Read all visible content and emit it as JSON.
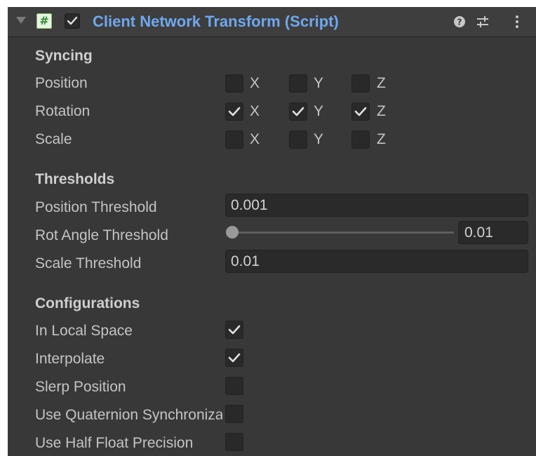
{
  "header": {
    "title": "Client Network Transform (Script)",
    "script_icon_glyph": "#",
    "enabled": true,
    "icons": [
      "foldout-arrow-icon",
      "script-icon",
      "help-icon",
      "settings-sliders-icon",
      "kebab-menu-icon"
    ]
  },
  "syncing": {
    "title": "Syncing",
    "rows": [
      {
        "label": "Position",
        "x": false,
        "y": false,
        "z": false
      },
      {
        "label": "Rotation",
        "x": true,
        "y": true,
        "z": true
      },
      {
        "label": "Scale",
        "x": false,
        "y": false,
        "z": false
      }
    ],
    "axis_labels": [
      "X",
      "Y",
      "Z"
    ]
  },
  "thresholds": {
    "title": "Thresholds",
    "position_threshold": {
      "label": "Position Threshold",
      "value": "0.001"
    },
    "rot_angle_threshold": {
      "label": "Rot Angle Threshold",
      "value": "0.01"
    },
    "scale_threshold": {
      "label": "Scale Threshold",
      "value": "0.01"
    }
  },
  "configurations": {
    "title": "Configurations",
    "items": [
      {
        "label": "In Local Space",
        "checked": true
      },
      {
        "label": "Interpolate",
        "checked": true
      },
      {
        "label": "Slerp Position",
        "checked": false
      },
      {
        "label": "Use Quaternion Synchronization",
        "checked": false
      },
      {
        "label": "Use Half Float Precision",
        "checked": false
      }
    ]
  },
  "colors": {
    "panel_bg": "#383838",
    "title_blue": "#6fa8ee",
    "text": "#c4c4c4",
    "field_bg": "#2a2a2a"
  }
}
